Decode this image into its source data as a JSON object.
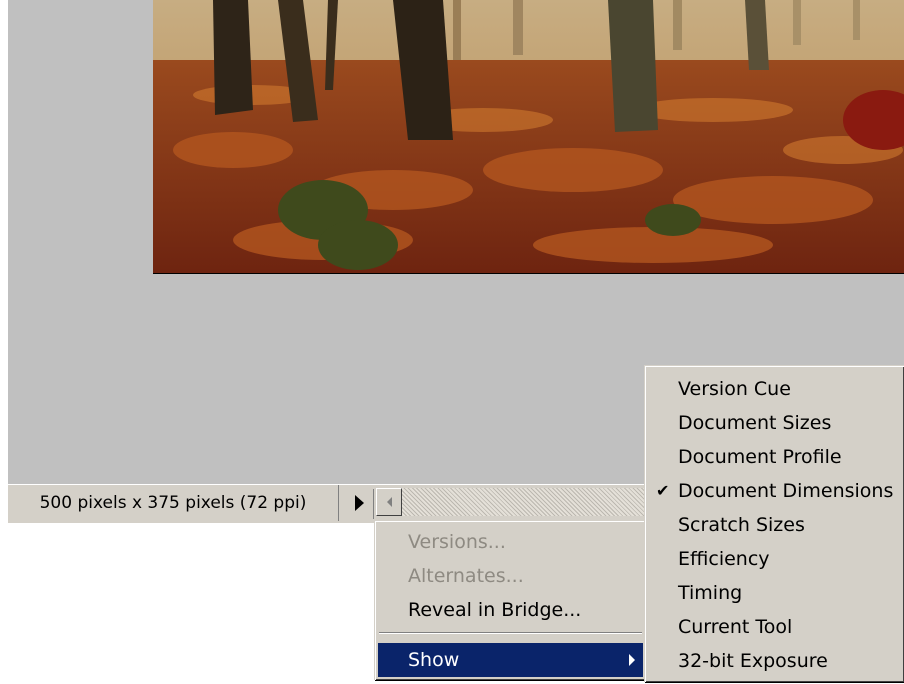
{
  "status_bar": {
    "info_text": "500 pixels x 375 pixels (72 ppi)"
  },
  "icons": {
    "status_menu": "right-triangle-icon",
    "scroll_left": "left-arrow-icon",
    "submenu": "submenu-arrow-icon",
    "check": "checkmark-icon"
  },
  "colors": {
    "workspace": "#c0c0c0",
    "chrome": "#d4d0c8",
    "highlight": "#0a246a"
  },
  "popup_menu": {
    "items": [
      {
        "label": "Versions...",
        "enabled": false
      },
      {
        "label": "Alternates...",
        "enabled": false
      },
      {
        "label": "Reveal in Bridge...",
        "enabled": true
      },
      {
        "label": "Show",
        "enabled": true,
        "highlighted": true,
        "submenu": true
      }
    ]
  },
  "show_submenu": {
    "items": [
      {
        "label": "Version Cue",
        "checked": false
      },
      {
        "label": "Document Sizes",
        "checked": false
      },
      {
        "label": "Document Profile",
        "checked": false
      },
      {
        "label": "Document Dimensions",
        "checked": true
      },
      {
        "label": "Scratch Sizes",
        "checked": false
      },
      {
        "label": "Efficiency",
        "checked": false
      },
      {
        "label": "Timing",
        "checked": false
      },
      {
        "label": "Current Tool",
        "checked": false
      },
      {
        "label": "32-bit Exposure",
        "checked": false
      }
    ]
  }
}
